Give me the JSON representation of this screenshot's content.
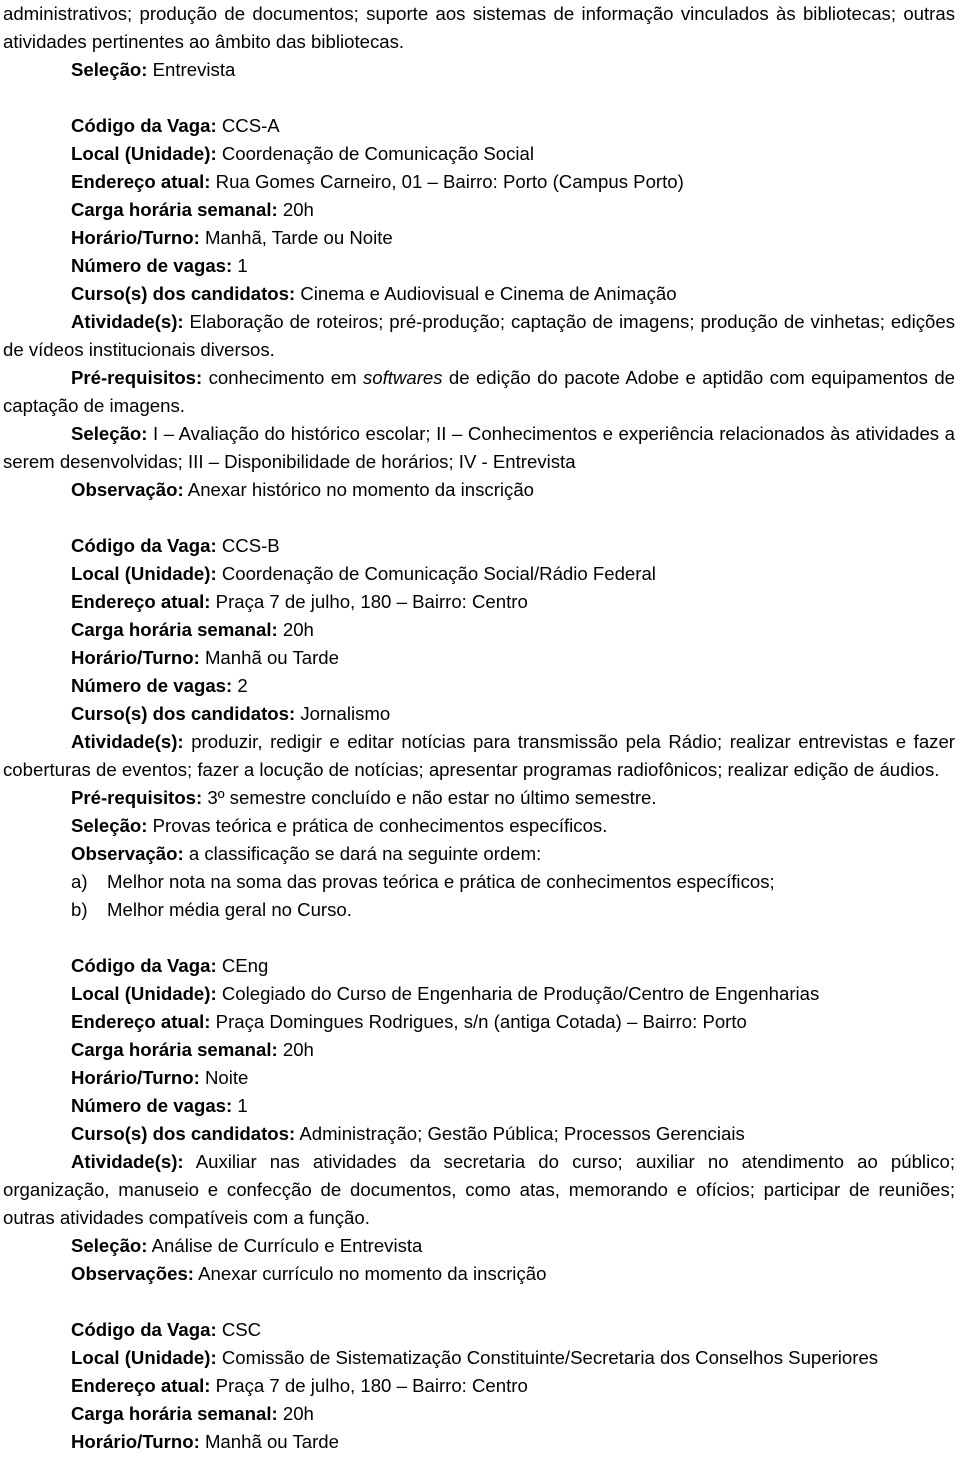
{
  "document": {
    "intro_continuation": "administrativos; produção de documentos; suporte aos sistemas de informação vinculados às bibliotecas; outras atividades pertinentes ao âmbito das bibliotecas.",
    "intro_selection_label": "Seleção:",
    "intro_selection_value": " Entrevista"
  },
  "labels": {
    "codigo": "Código da Vaga:",
    "local": "Local (Unidade):",
    "endereco": "Endereço atual:",
    "carga": "Carga horária semanal:",
    "horario": "Horário/Turno:",
    "vagas": "Número de vagas:",
    "cursos": "Curso(s) dos candidatos:",
    "atividades": "Atividade(s):",
    "prerequisitos": "Pré-requisitos:",
    "selecao": "Seleção:",
    "observacao": "Observação:",
    "observacao_alt": "Observação:",
    "observacoes": "Observações:"
  },
  "vagas": [
    {
      "codigo": " CCS-A",
      "local": " Coordenação de Comunicação Social",
      "endereco": " Rua Gomes Carneiro, 01 – Bairro: Porto (Campus Porto)",
      "carga": " 20h",
      "horario": " Manhã, Tarde ou Noite",
      "vagas": " 1",
      "cursos": " Cinema e Audiovisual e Cinema de Animação",
      "atividades": " Elaboração de roteiros; pré-produção; captação de imagens; produção de vinhetas; edições de vídeos institucionais diversos.",
      "prereq_part1": " conhecimento em ",
      "prereq_italic": "softwares",
      "prereq_part2": " de edição do pacote Adobe e aptidão com equipamentos de captação de imagens.",
      "selecao": " I – Avaliação do histórico escolar; II – Conhecimentos e experiência relacionados às atividades a serem desenvolvidas; III – Disponibilidade de horários; IV - Entrevista",
      "observacao": " Anexar histórico no momento da inscrição"
    },
    {
      "codigo": " CCS-B",
      "local": " Coordenação de Comunicação Social/Rádio Federal",
      "endereco": " Praça 7 de julho, 180 – Bairro: Centro",
      "carga": " 20h",
      "horario": " Manhã ou Tarde",
      "vagas": " 2",
      "cursos": " Jornalismo",
      "atividades": " produzir, redigir e editar notícias para transmissão pela Rádio; realizar entrevistas e fazer coberturas de eventos; fazer a locução de notícias; apresentar programas radiofônicos; realizar edição de áudios.",
      "prerequisitos": " 3º semestre concluído e não estar no último semestre.",
      "selecao": " Provas teórica e prática de conhecimentos específicos.",
      "observacao": " a classificação se dará na seguinte ordem:",
      "lista": [
        {
          "marker": "a)",
          "text": "Melhor nota na soma das provas teórica e prática de conhecimentos específicos;"
        },
        {
          "marker": "b)",
          "text": "Melhor média geral no Curso."
        }
      ]
    },
    {
      "codigo": " CEng",
      "local": " Colegiado do Curso de Engenharia de Produção/Centro de Engenharias",
      "endereco": " Praça Domingues Rodrigues, s/n (antiga Cotada) – Bairro: Porto",
      "carga": " 20h",
      "horario": " Noite",
      "vagas": " 1",
      "cursos": " Administração; Gestão Pública; Processos Gerenciais",
      "atividades": " Auxiliar nas atividades da secretaria do curso; auxiliar no atendimento ao público; organização, manuseio e confecção de documentos, como atas, memorando e ofícios; participar de reuniões; outras atividades compatíveis com a função.",
      "selecao": " Análise de Currículo e Entrevista",
      "observacoes": " Anexar currículo no momento da inscrição"
    },
    {
      "codigo": " CSC",
      "local": " Comissão de Sistematização Constituinte/Secretaria dos Conselhos Superiores",
      "endereco": " Praça 7 de julho, 180 – Bairro: Centro",
      "carga": " 20h",
      "horario": " Manhã ou Tarde"
    }
  ]
}
